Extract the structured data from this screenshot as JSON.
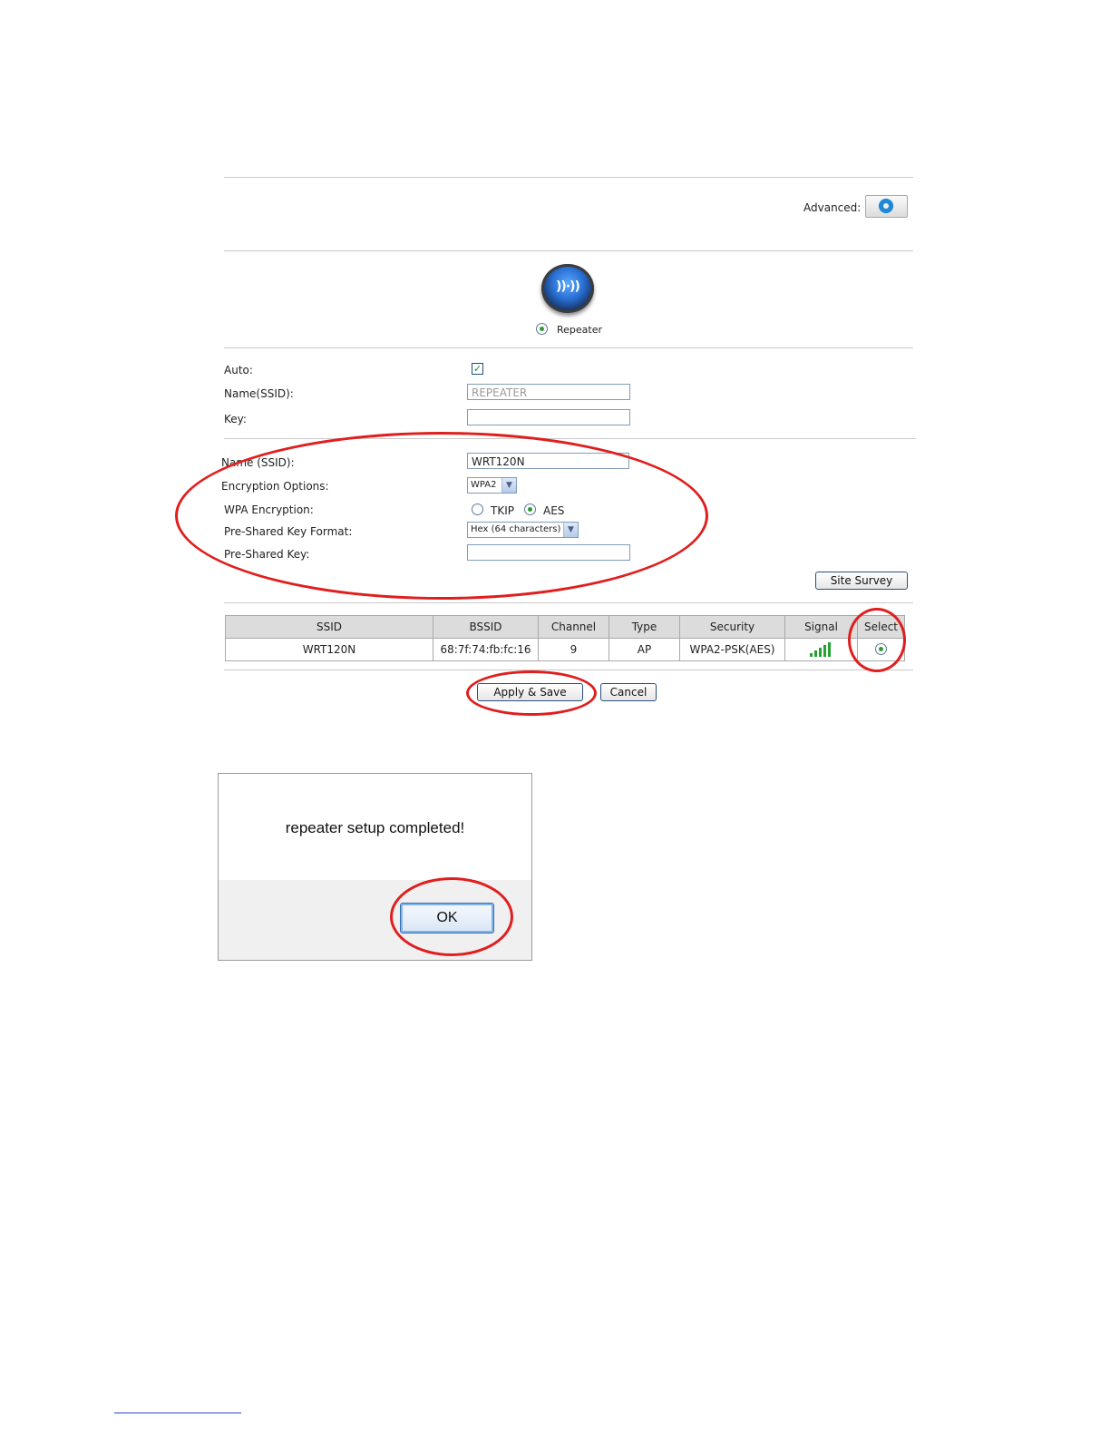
{
  "header": {
    "advanced_label": "Advanced:",
    "advanced_icon": "gear-icon"
  },
  "mode": {
    "icon": "repeater-wireless-icon",
    "icon_glyph": "))·))",
    "label": "Repeater",
    "selected": true
  },
  "local": {
    "auto_label": "Auto:",
    "auto_checked": true,
    "auto_check_glyph": "✓",
    "ssid_label": "Name(SSID):",
    "ssid_value": "REPEATER",
    "key_label": "Key:",
    "key_value": ""
  },
  "remote": {
    "ssid_label": "Name (SSID):",
    "ssid_value": "WRT120N",
    "encryption_label": "Encryption Options:",
    "encryption_value": "WPA2",
    "wpa_label": "WPA Encryption:",
    "wpa_options": [
      "TKIP",
      "AES"
    ],
    "wpa_selected": "AES",
    "psk_format_label": "Pre-Shared Key Format:",
    "psk_format_value": "Hex (64 characters)",
    "psk_label": "Pre-Shared Key:",
    "psk_value": "",
    "select_arrow_glyph": "▼"
  },
  "site_survey_label": "Site Survey",
  "survey_table": {
    "columns": [
      "SSID",
      "BSSID",
      "Channel",
      "Type",
      "Security",
      "Signal",
      "Select"
    ],
    "rows": [
      {
        "ssid": "WRT120N",
        "bssid": "68:7f:74:fb:fc:16",
        "channel": "9",
        "type": "AP",
        "security": "WPA2-PSK(AES)",
        "signal_bars": 5,
        "selected": true
      }
    ]
  },
  "actions": {
    "apply_label": "Apply & Save",
    "cancel_label": "Cancel"
  },
  "dialog": {
    "message": "repeater setup completed!",
    "ok_label": "OK"
  },
  "colors": {
    "annotation_ring": "#e01e1e",
    "signal_green": "#24a32e",
    "gear_blue": "#1e8ad6"
  }
}
